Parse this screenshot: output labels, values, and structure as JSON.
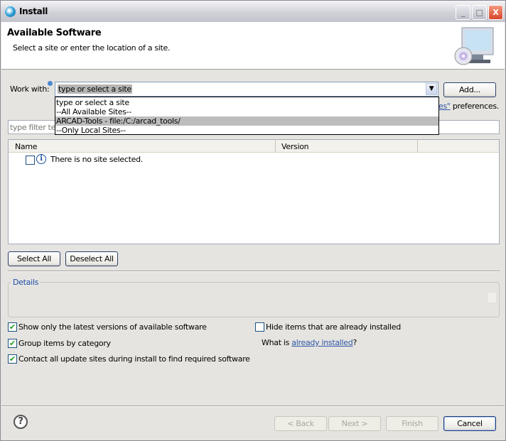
{
  "window": {
    "title": "Install",
    "minimize": "_",
    "maximize": "□",
    "close": "X"
  },
  "banner": {
    "title": "Available Software",
    "subtitle": "Select a site or enter the location of a site."
  },
  "work_with": {
    "label": "Work with:",
    "value": "type or select a site",
    "add_label": "Add...",
    "options": [
      "type or select a site",
      "--All Available Sites--",
      "ARCAD-Tools - file:/C:/arcad_tools/",
      "--Only Local Sites--"
    ],
    "highlighted_index": 2,
    "hidden_link_fragment": "es\"",
    "hidden_suffix": " preferences."
  },
  "filter": {
    "placeholder": "type filter text",
    "visible_text": "type filter te"
  },
  "table": {
    "columns": [
      "Name",
      "Version"
    ],
    "rows": [
      {
        "checked": false,
        "icon": "info-icon",
        "text": "There is no site selected."
      }
    ]
  },
  "buttons": {
    "select_all": "Select All",
    "deselect_all": "Deselect All",
    "back": "< Back",
    "next": "Next >",
    "finish": "Finish",
    "cancel": "Cancel"
  },
  "details": {
    "label": "Details"
  },
  "options": {
    "show_latest": {
      "label": "Show only the latest versions of available software",
      "checked": true
    },
    "group_by_category": {
      "label": "Group items by category",
      "checked": true
    },
    "contact_all": {
      "label": "Contact all update sites during install to find required software",
      "checked": true
    },
    "hide_installed": {
      "label": "Hide items that are already installed",
      "checked": false
    },
    "what_is_prefix": "What is ",
    "what_is_link": "already installed",
    "what_is_suffix": "?"
  },
  "check_glyph": "✔"
}
